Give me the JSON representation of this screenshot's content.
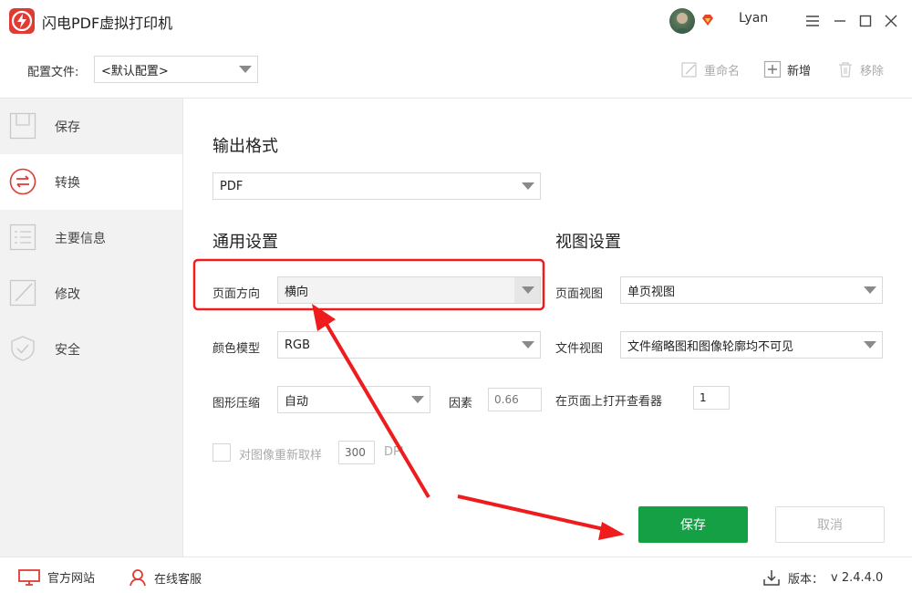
{
  "window": {
    "title": "闪电PDF虚拟打印机",
    "user": "Lyan"
  },
  "profile": {
    "label": "配置文件:",
    "value": "<默认配置>",
    "rename": "重命名",
    "add": "新增",
    "remove": "移除"
  },
  "sidebar": {
    "items": [
      {
        "label": "保存",
        "icon": "save-icon"
      },
      {
        "label": "转换",
        "icon": "convert-icon"
      },
      {
        "label": "主要信息",
        "icon": "info-icon"
      },
      {
        "label": "修改",
        "icon": "edit-icon"
      },
      {
        "label": "安全",
        "icon": "shield-icon"
      }
    ],
    "active": "转换"
  },
  "output": {
    "title": "输出格式",
    "format": "PDF"
  },
  "general": {
    "title": "通用设置",
    "orientation_label": "页面方向",
    "orientation_value": "横向",
    "color_label": "颜色模型",
    "color_value": "RGB",
    "compress_label": "图形压缩",
    "compress_value": "自动",
    "factor_label": "因素",
    "factor_value": "0.66",
    "resample_label": "对图像重新取样",
    "resample_value": "300",
    "resample_unit": "DPI"
  },
  "view": {
    "title": "视图设置",
    "page_view_label": "页面视图",
    "page_view_value": "单页视图",
    "doc_view_label": "文件视图",
    "doc_view_value": "文件缩略图和图像轮廓均不可见",
    "open_viewer_label": "在页面上打开查看器",
    "open_viewer_value": "1"
  },
  "actions": {
    "save": "保存",
    "cancel": "取消"
  },
  "footer": {
    "website": "官方网站",
    "support": "在线客服",
    "version_label": "版本：",
    "version": "v 2.4.4.0"
  },
  "colors": {
    "accent_green": "#15a045",
    "brand_red": "#e03a32",
    "annotation_red": "#ee1c1c"
  }
}
